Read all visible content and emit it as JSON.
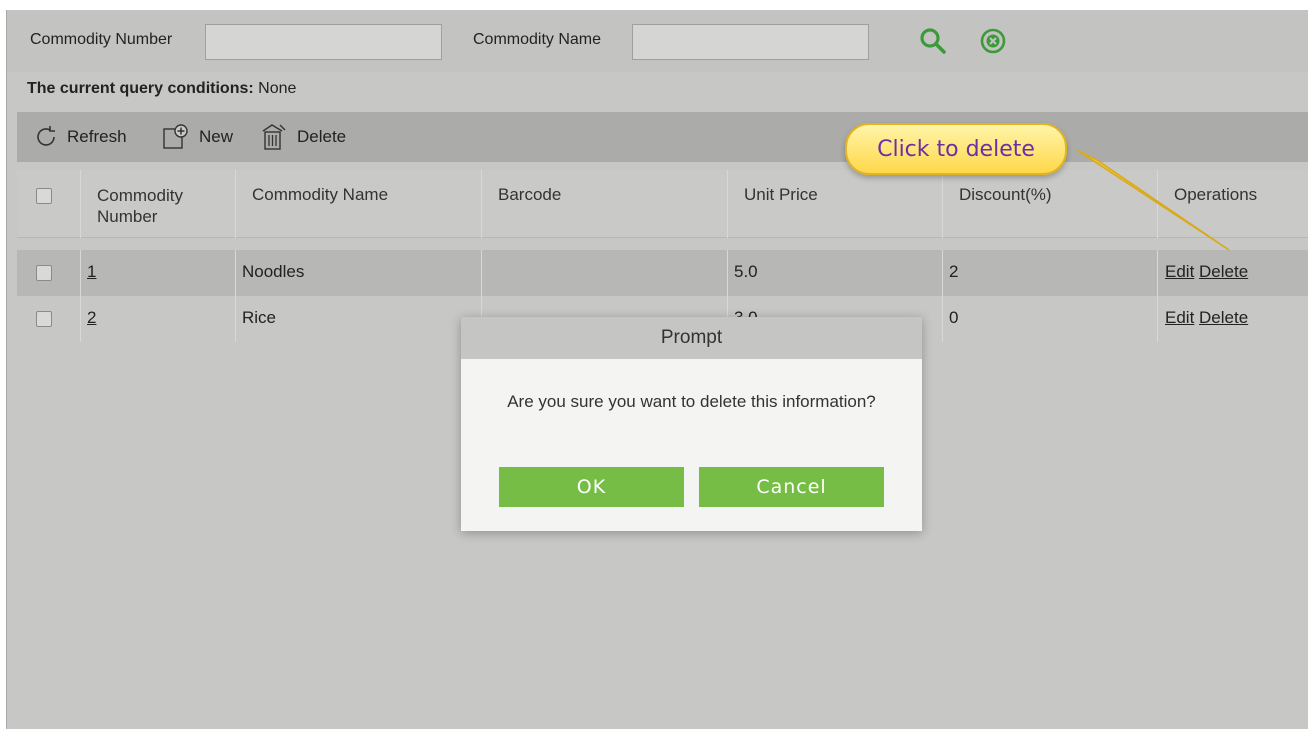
{
  "search": {
    "commodity_number_label": "Commodity Number",
    "commodity_number_value": "",
    "commodity_name_label": "Commodity Name",
    "commodity_name_value": "",
    "search_icon": "search-icon",
    "clear_icon": "clear-circle-icon"
  },
  "query": {
    "label": "The current query conditions:",
    "value": "None"
  },
  "toolbar": {
    "refresh_label": "Refresh",
    "new_label": "New",
    "delete_label": "Delete"
  },
  "table": {
    "headers": [
      "Commodity Number",
      "Commodity Name",
      "Barcode",
      "Unit Price",
      "Discount(%)",
      "Operations"
    ],
    "rows": [
      {
        "number": "1",
        "name": "Noodles",
        "barcode": "",
        "unit_price": "5.0",
        "discount": "2",
        "edit": "Edit",
        "delete": "Delete"
      },
      {
        "number": "2",
        "name": "Rice",
        "barcode": "",
        "unit_price": "3.0",
        "discount": "0",
        "edit": "Edit",
        "delete": "Delete"
      }
    ]
  },
  "callout": {
    "text": "Click to delete"
  },
  "dialog": {
    "title": "Prompt",
    "message": "Are you sure you want to delete this information?",
    "ok_label": "OK",
    "cancel_label": "Cancel"
  },
  "colors": {
    "accent_green": "#76bd45",
    "search_icon_green": "#3d9a3a",
    "callout_fill": "#ffd84a",
    "callout_text": "#6b2fa6"
  }
}
